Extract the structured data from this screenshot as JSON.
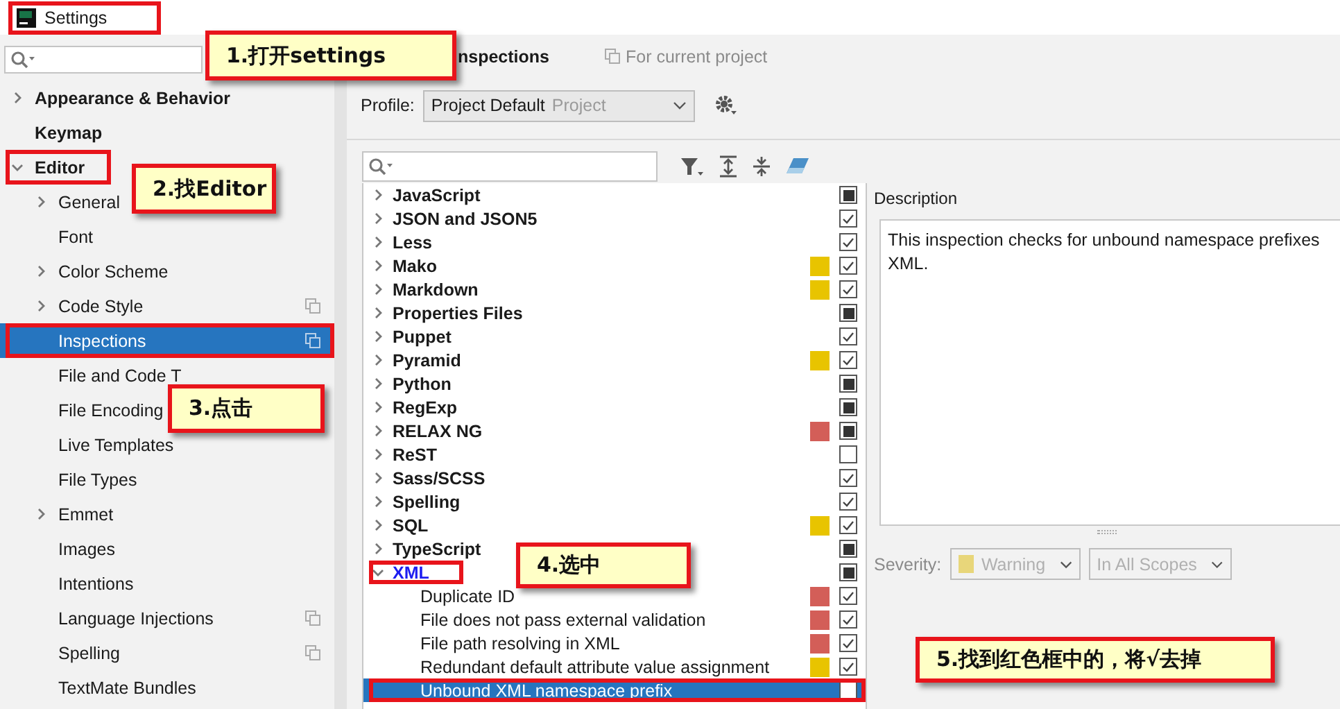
{
  "window": {
    "title": "Settings",
    "framed": true
  },
  "sidebar": {
    "items": [
      {
        "label": "Appearance & Behavior",
        "expanded": false,
        "selected": false
      },
      {
        "label": "Keymap",
        "selected": false
      },
      {
        "label": "Editor",
        "expanded": true,
        "selected": false,
        "framed": true,
        "children": [
          {
            "label": "General",
            "expanded": false,
            "selected": false
          },
          {
            "label": "Font",
            "selected": false
          },
          {
            "label": "Color Scheme",
            "expanded": false,
            "selected": false
          },
          {
            "label": "Code Style",
            "expanded": false,
            "selected": false,
            "shared": true
          },
          {
            "label": "Inspections",
            "selected": true,
            "framed": true,
            "shared": true
          },
          {
            "label": "File and Code T",
            "selected": false
          },
          {
            "label": "File Encoding",
            "selected": false
          },
          {
            "label": "Live Templates",
            "selected": false
          },
          {
            "label": "File Types",
            "selected": false
          },
          {
            "label": "Emmet",
            "expanded": false,
            "selected": false
          },
          {
            "label": "Images",
            "selected": false
          },
          {
            "label": "Intentions",
            "selected": false
          },
          {
            "label": "Language Injections",
            "selected": false,
            "shared": true
          },
          {
            "label": "Spelling",
            "selected": false,
            "shared": true
          },
          {
            "label": "TextMate Bundles",
            "selected": false
          }
        ]
      }
    ]
  },
  "header": {
    "title": "nspections",
    "scope": "For current project"
  },
  "profile": {
    "label": "Profile:",
    "value": "Project Default",
    "type": "Project"
  },
  "inspections": [
    {
      "name": "JavaScript",
      "checked": true,
      "partial": true,
      "expanded": false,
      "selected": false
    },
    {
      "name": "JSON and JSON5",
      "checked": true,
      "expanded": false,
      "selected": false
    },
    {
      "name": "Less",
      "checked": true,
      "expanded": false,
      "selected": false
    },
    {
      "name": "Mako",
      "checked": true,
      "color": "#e8c400",
      "expanded": false,
      "selected": false
    },
    {
      "name": "Markdown",
      "checked": true,
      "color": "#e8c400",
      "expanded": false,
      "selected": false
    },
    {
      "name": "Properties Files",
      "checked": true,
      "partial": true,
      "expanded": false,
      "selected": false
    },
    {
      "name": "Puppet",
      "checked": true,
      "expanded": false,
      "selected": false
    },
    {
      "name": "Pyramid",
      "checked": true,
      "color": "#e8c400",
      "expanded": false,
      "selected": false
    },
    {
      "name": "Python",
      "checked": true,
      "partial": true,
      "expanded": false,
      "selected": false
    },
    {
      "name": "RegExp",
      "checked": true,
      "partial": true,
      "expanded": false,
      "selected": false
    },
    {
      "name": "RELAX NG",
      "checked": true,
      "partial": true,
      "color": "#d35e58",
      "expanded": false,
      "selected": false
    },
    {
      "name": "ReST",
      "checked": false,
      "expanded": false,
      "selected": false
    },
    {
      "name": "Sass/SCSS",
      "checked": true,
      "expanded": false,
      "selected": false
    },
    {
      "name": "Spelling",
      "checked": true,
      "expanded": false,
      "selected": false
    },
    {
      "name": "SQL",
      "checked": true,
      "color": "#e8c400",
      "expanded": false,
      "selected": false
    },
    {
      "name": "TypeScript",
      "checked": true,
      "partial": true,
      "expanded": false,
      "selected": false
    },
    {
      "name": "XML",
      "checked": true,
      "partial": true,
      "expanded": true,
      "selected": false,
      "framed": true,
      "modified": true,
      "children": [
        {
          "name": "Duplicate ID",
          "checked": true,
          "color": "#d35e58",
          "selected": false
        },
        {
          "name": "File does not pass external validation",
          "checked": true,
          "color": "#d35e58",
          "selected": false
        },
        {
          "name": "File path resolving in XML",
          "checked": true,
          "color": "#d35e58",
          "selected": false
        },
        {
          "name": "Redundant default attribute value assignment",
          "checked": true,
          "color": "#e8c400",
          "selected": false
        },
        {
          "name": "Unbound XML namespace prefix",
          "checked": false,
          "selected": true,
          "framed": true
        }
      ]
    }
  ],
  "description": {
    "label": "Description",
    "lines": [
      "This inspection checks for unbound namespace prefixes",
      "XML."
    ]
  },
  "severity": {
    "label": "Severity:",
    "value": "Warning",
    "color": "#e8d67a",
    "scope": "In All Scopes",
    "disabled": true
  },
  "callouts": [
    {
      "text": "1.打开settings"
    },
    {
      "text": "2.找Editor"
    },
    {
      "text": "3.点击"
    },
    {
      "text": "4.选中"
    },
    {
      "text": "5.找到红色框中的，将√去掉"
    }
  ]
}
